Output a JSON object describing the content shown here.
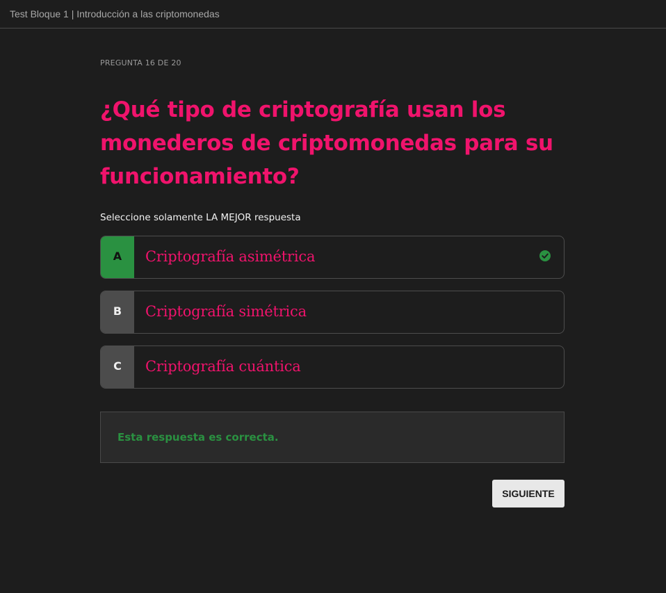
{
  "header": {
    "title": "Test Bloque 1 | Introducción a las criptomonedas"
  },
  "quiz": {
    "counter": "PREGUNTA 16 DE 20",
    "question": "¿Qué tipo de criptografía usan los monederos de criptomonedas para su funcionamiento?",
    "instruction": "Seleccione solamente LA MEJOR respuesta",
    "options": [
      {
        "letter": "A",
        "text": "Criptografía asimétrica",
        "state": "correct",
        "icon": "check-circle-icon"
      },
      {
        "letter": "B",
        "text": "Criptografía simétrica",
        "state": "neutral"
      },
      {
        "letter": "C",
        "text": "Criptografía cuántica",
        "state": "neutral"
      }
    ],
    "feedback": "Esta respuesta es correcta.",
    "next_label": "SIGUIENTE"
  },
  "colors": {
    "background": "#1d1d1d",
    "accent": "#f0136c",
    "correct": "#2a9141",
    "neutral_letter": "#4c4c4c"
  }
}
